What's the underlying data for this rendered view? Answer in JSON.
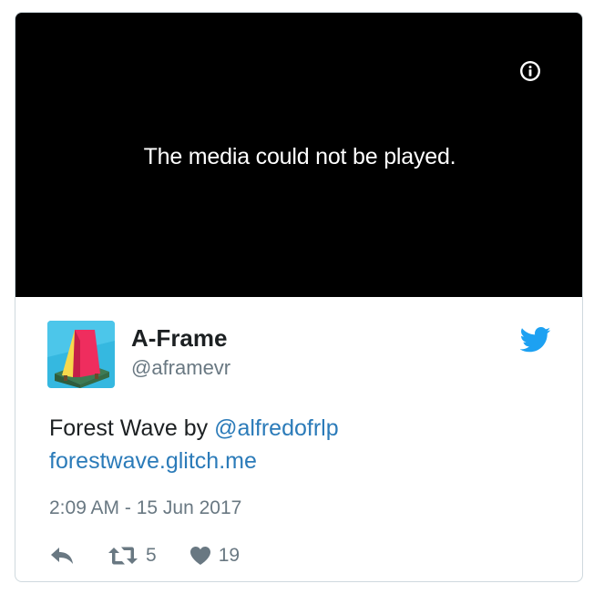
{
  "media": {
    "error_message": "The media could not be played.",
    "info_icon": "info-icon"
  },
  "tweet": {
    "author": {
      "display_name": "A-Frame",
      "handle": "@aframevr",
      "avatar_icon": "a-frame-logo"
    },
    "text": {
      "prefix": "Forest Wave by ",
      "mention": "@alfredofrlp",
      "link": "forestwave.glitch.me"
    },
    "timestamp": "2:09 AM - 15 Jun 2017",
    "actions": {
      "reply_icon": "reply-icon",
      "retweet_icon": "retweet-icon",
      "retweet_count": "5",
      "like_icon": "heart-icon",
      "like_count": "19"
    },
    "brand_icon": "twitter-bird-icon"
  },
  "colors": {
    "link": "#2b7bb9",
    "secondary_text": "#697882",
    "primary_text": "#1c2022",
    "twitter_blue": "#1da1f2",
    "media_background": "#000000"
  }
}
